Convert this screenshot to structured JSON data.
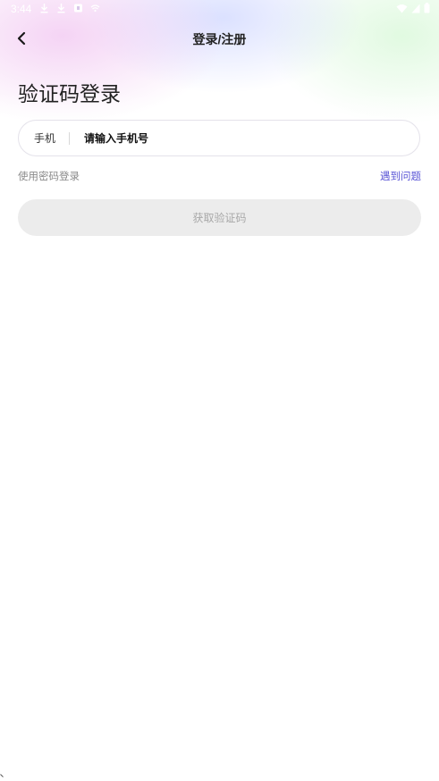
{
  "status_bar": {
    "time": "3:44",
    "left_icons": [
      "download-icon",
      "download-icon",
      "notification-icon",
      "cast-icon"
    ],
    "right_icons": [
      "wifi-icon",
      "signal-icon",
      "battery-icon"
    ]
  },
  "nav": {
    "back_icon": "chevron-left-icon",
    "title": "登录/注册"
  },
  "main": {
    "heading": "验证码登录",
    "phone_field": {
      "label": "手机",
      "placeholder": "请输入手机号",
      "value": ""
    },
    "password_login_link": "使用密码登录",
    "help_link": "遇到问题",
    "get_code_button": "获取验证码"
  },
  "colors": {
    "accent_link": "#5a55d6",
    "button_disabled_bg": "#ececec",
    "button_disabled_text": "#a8a8a8"
  }
}
